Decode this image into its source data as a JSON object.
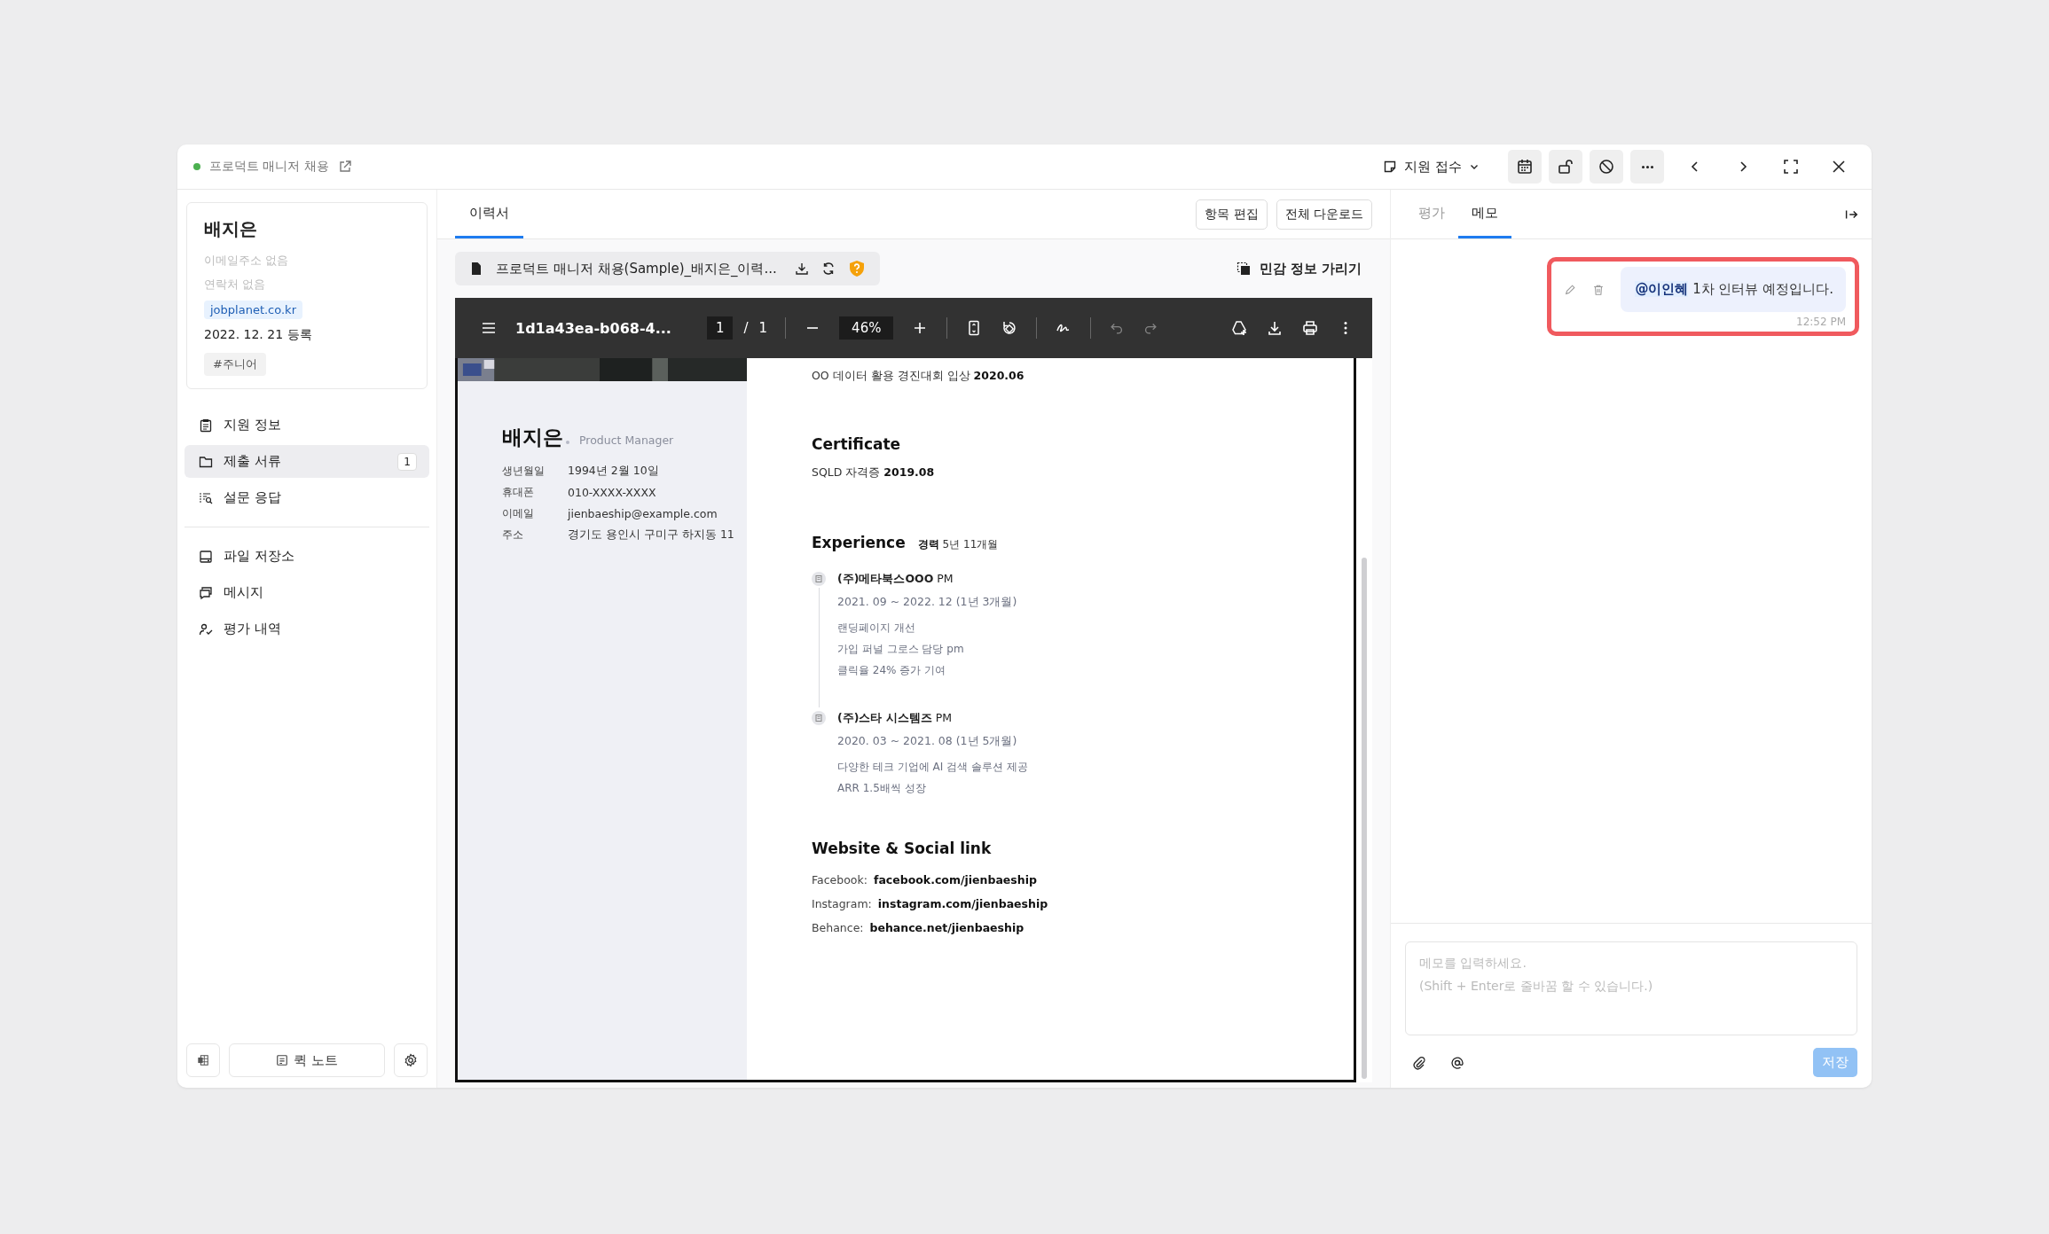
{
  "header": {
    "job_title": "프로덕트 매니저 채용",
    "stage": "지원 접수"
  },
  "candidate": {
    "name": "배지은",
    "email": "이메일주소 없음",
    "phone": "연락처 없음",
    "source": "jobplanet.co.kr",
    "registered": "2022. 12. 21 등록",
    "tags": [
      "#주니어"
    ]
  },
  "nav": [
    {
      "label": "지원 정보",
      "selected": false
    },
    {
      "label": "제출 서류",
      "selected": true,
      "count": "1"
    },
    {
      "label": "설문 응답",
      "selected": false
    }
  ],
  "nav2": [
    {
      "label": "파일 저장소",
      "selected": false
    },
    {
      "label": "메시지",
      "selected": false
    },
    {
      "label": "평가 내역",
      "selected": false
    }
  ],
  "quick_note": "퀵 노트",
  "doc_tabs": [
    {
      "label": "이력서",
      "selected": true
    }
  ],
  "doc_actions": [
    "항목 편집",
    "전체 다운로드"
  ],
  "file": {
    "name": "프로덕트 매니저 채용(Sample)_배지은_이력...",
    "mask_label": "민감 정보 가리기"
  },
  "viewer": {
    "file": "1d1a43ea-b068-4...",
    "page": "1",
    "page_separator": "/",
    "pages": "1",
    "zoom": "46%",
    "undo_disabled": true,
    "redo_disabled": true
  },
  "resume": {
    "name": "배지은",
    "title": "Product Manager",
    "fields": [
      {
        "label": "생년월일",
        "value": "1994년 2월 10일"
      },
      {
        "label": "휴대폰",
        "value": "010-XXXX-XXXX"
      },
      {
        "label": "이메일",
        "value": "jienbaeship@example.com"
      },
      {
        "label": "주소",
        "value": "경기도 용인시 구미구 하지동 11"
      }
    ],
    "award": "OO 데이터 활용 경진대회 입상  **2020.06**",
    "certificate": {
      "heading": "Certificate",
      "text": "SQLD 자격증  **2019.08**"
    },
    "experience": {
      "heading": "Experience",
      "summary": "**경력** 5년 11개월",
      "jobs": [
        {
          "company": "(주)메타북스OOO",
          "role": "PM",
          "period": "2021. 09 ~ 2022. 12 (1년 3개월)",
          "details": [
            "랜딩페이지 개선",
            "가입 퍼널 그로스 담당 pm",
            "클릭율 24% 증가 기여"
          ]
        },
        {
          "company": "(주)스타 시스템즈",
          "role": "PM",
          "period": "2020. 03 ~ 2021. 08 (1년 5개월)",
          "details": [
            "다양한 테크 기업에 AI 검색 솔루션 제공",
            "ARR 1.5배씩 성장"
          ]
        }
      ]
    },
    "links": {
      "heading": "Website & Social link",
      "items": [
        {
          "label": "Facebook:",
          "url": "facebook.com/jienbaeship"
        },
        {
          "label": "Instagram:",
          "url": "instagram.com/jienbaeship"
        },
        {
          "label": "Behance:",
          "url": "behance.net/jienbaeship"
        }
      ]
    }
  },
  "side_tabs": [
    {
      "label": "평가",
      "selected": false
    },
    {
      "label": "메모",
      "selected": true
    }
  ],
  "memos": [
    {
      "mention": "@이인혜",
      "text": "1차 인터뷰 예정입니다.",
      "time": "12:52 PM",
      "highlighted": true
    }
  ],
  "memo_input": {
    "placeholder": "메모를 입력하세요.\n(Shift + Enter로 줄바꿈 할 수 있습니다.)"
  },
  "save": "저장"
}
